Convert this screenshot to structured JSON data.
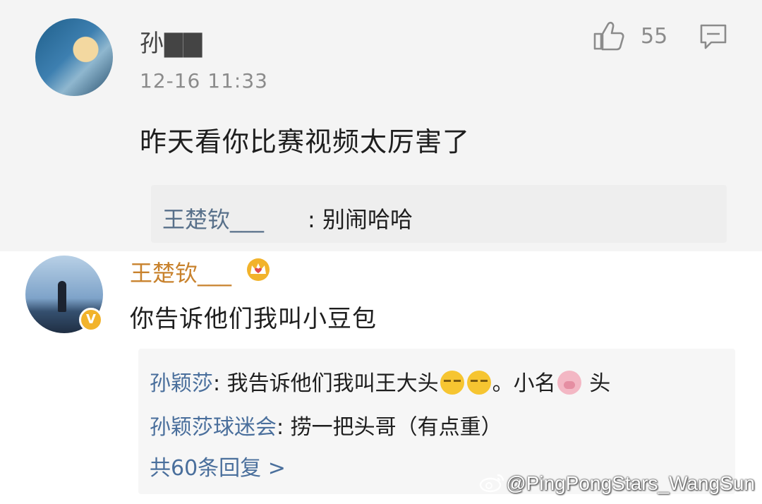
{
  "comment1": {
    "username": "孙▇▇",
    "time": "12-16 11:33",
    "text": "昨天看你比赛视频太厉害了",
    "like_count": "55",
    "reply": {
      "name": "王楚钦___",
      "text": ": 别闹哈哈"
    }
  },
  "comment2": {
    "username": "王楚钦___",
    "badge": "V",
    "text": "你告诉他们我叫小豆包",
    "replies": [
      {
        "name": "孙颖莎",
        "text_before": ": 我告诉他们我叫王大头",
        "text_mid": "。小名",
        "text_after": " 头"
      },
      {
        "name": "孙颖莎球迷会",
        "text": ": 捞一把头哥（有点重）"
      }
    ],
    "more_replies": "共60条回复 >"
  },
  "watermark": "@PingPongStars_WangSun",
  "colors": {
    "reply_name": "#4a6f9c",
    "vip_name": "#c8822d",
    "verified_badge": "#f2b32b"
  }
}
